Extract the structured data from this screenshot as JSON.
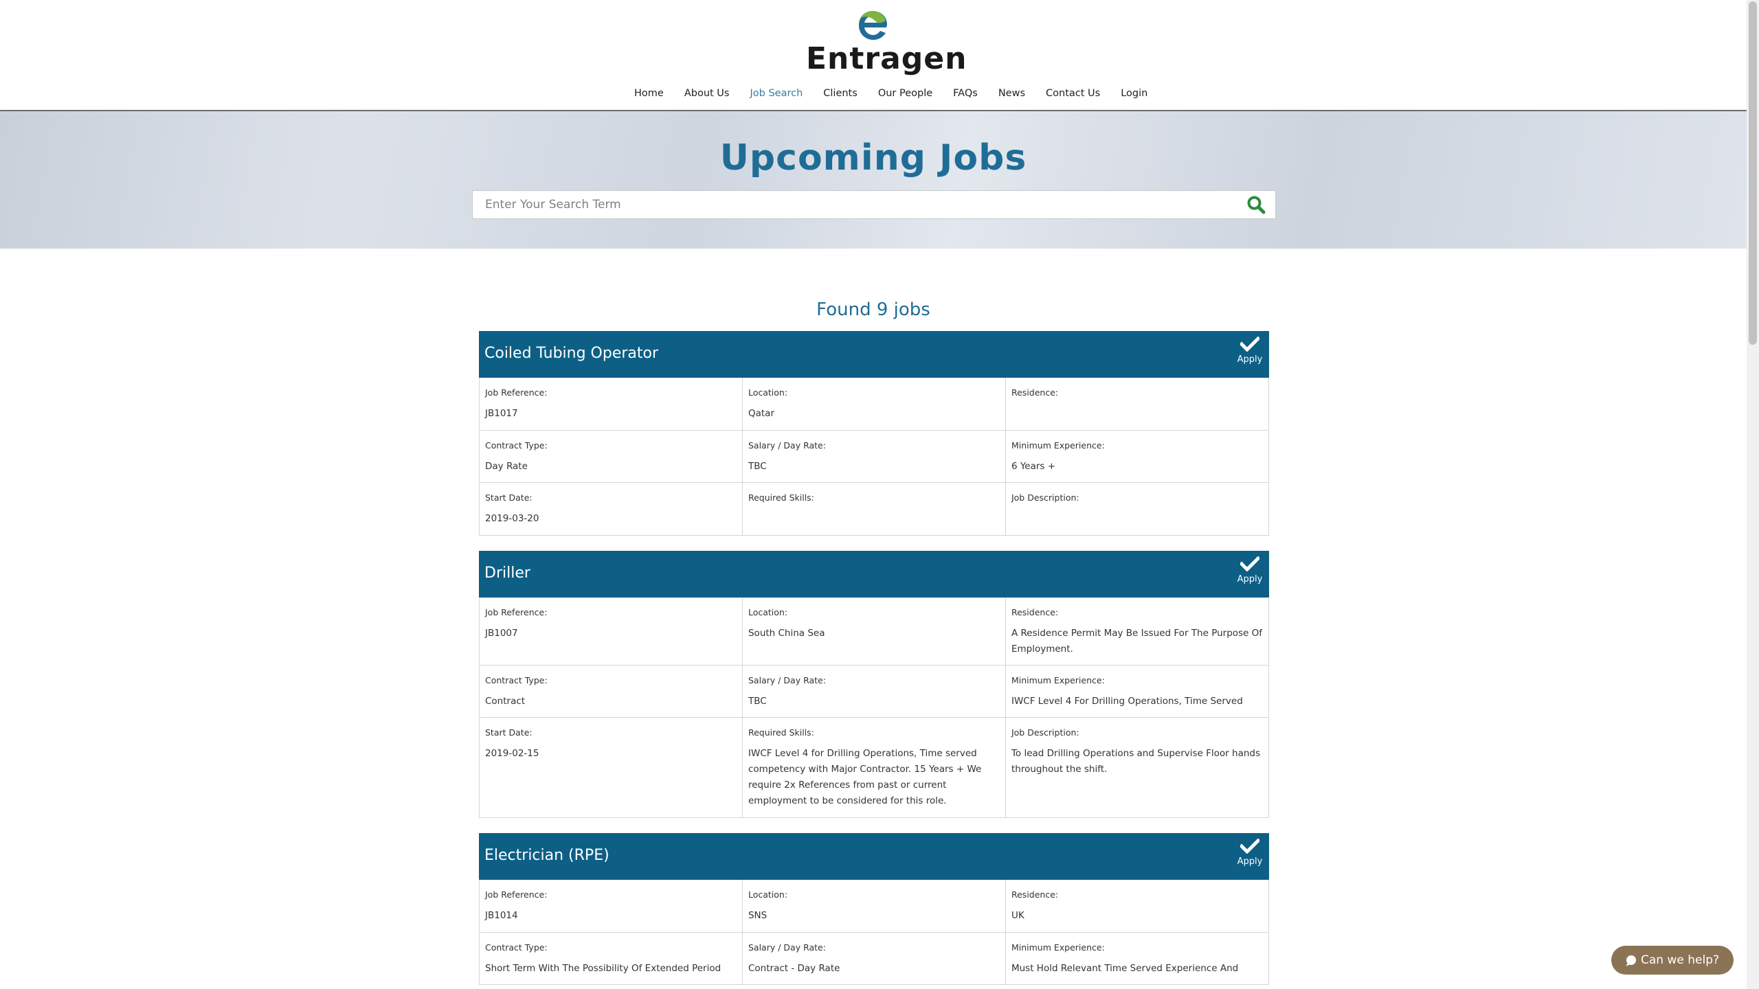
{
  "brand": {
    "name": "Entragen",
    "logo_icon": "leaf-e-logo-icon"
  },
  "nav": {
    "items": [
      {
        "label": "Home"
      },
      {
        "label": "About Us"
      },
      {
        "label": "Job Search",
        "active": true
      },
      {
        "label": "Clients"
      },
      {
        "label": "Our People"
      },
      {
        "label": "FAQs"
      },
      {
        "label": "News"
      },
      {
        "label": "Contact Us"
      },
      {
        "label": "Login"
      }
    ]
  },
  "hero": {
    "title": "Upcoming Jobs",
    "search_placeholder": "Enter Your Search Term",
    "search_value": "",
    "search_icon": "search-icon"
  },
  "results": {
    "found_text": "Found 9 jobs"
  },
  "jobs": [
    {
      "title": "Coiled Tubing Operator",
      "apply_label": "Apply",
      "fields": {
        "job_reference": {
          "label": "Job Reference:",
          "value": "JB1017"
        },
        "location": {
          "label": "Location:",
          "value": "Qatar"
        },
        "residence": {
          "label": "Residence:",
          "value": ""
        },
        "contract_type": {
          "label": "Contract Type:",
          "value": "Day Rate"
        },
        "salary": {
          "label": "Salary / Day Rate:",
          "value": "TBC"
        },
        "min_experience": {
          "label": "Minimum Experience:",
          "value": "6 Years +"
        },
        "start_date": {
          "label": "Start Date:",
          "value": "2019-03-20"
        },
        "required_skills": {
          "label": "Required Skills:",
          "value": ""
        },
        "job_description": {
          "label": "Job Description:",
          "value": ""
        }
      }
    },
    {
      "title": "Driller",
      "apply_label": "Apply",
      "fields": {
        "job_reference": {
          "label": "Job Reference:",
          "value": "JB1007"
        },
        "location": {
          "label": "Location:",
          "value": "South China Sea"
        },
        "residence": {
          "label": "Residence:",
          "value": "A Residence Permit May Be Issued For The Purpose Of Employment."
        },
        "contract_type": {
          "label": "Contract Type:",
          "value": "Contract"
        },
        "salary": {
          "label": "Salary / Day Rate:",
          "value": "TBC"
        },
        "min_experience": {
          "label": "Minimum Experience:",
          "value": "IWCF Level 4 For Drilling Operations, Time Served"
        },
        "start_date": {
          "label": "Start Date:",
          "value": "2019-02-15"
        },
        "required_skills": {
          "label": "Required Skills:",
          "value": "IWCF Level 4 for Drilling Operations, Time served competency with Major Contractor. 15 Years + We require 2x References from past or current employment to be considered for this role."
        },
        "job_description": {
          "label": "Job Description:",
          "value": "To lead Drilling Operations and Supervise Floor hands throughout the shift."
        }
      }
    },
    {
      "title": "Electrician (RPE)",
      "apply_label": "Apply",
      "fields": {
        "job_reference": {
          "label": "Job Reference:",
          "value": "JB1014"
        },
        "location": {
          "label": "Location:",
          "value": "SNS"
        },
        "residence": {
          "label": "Residence:",
          "value": "UK"
        },
        "contract_type": {
          "label": "Contract Type:",
          "value": "Short Term With The Possibility Of Extended Period"
        },
        "salary": {
          "label": "Salary / Day Rate:",
          "value": "Contract - Day Rate"
        },
        "min_experience": {
          "label": "Minimum Experience:",
          "value": "Must Hold Relevant Time Served Experience And"
        }
      }
    }
  ],
  "chat": {
    "label": "Can we help?",
    "icon": "chat-bubble-icon",
    "color": "#8b7355"
  },
  "colors": {
    "primary": "#0d5f86",
    "accent": "#1f6d96",
    "active_nav": "#2e7fa6",
    "search_icon": "#2e8b3a"
  }
}
